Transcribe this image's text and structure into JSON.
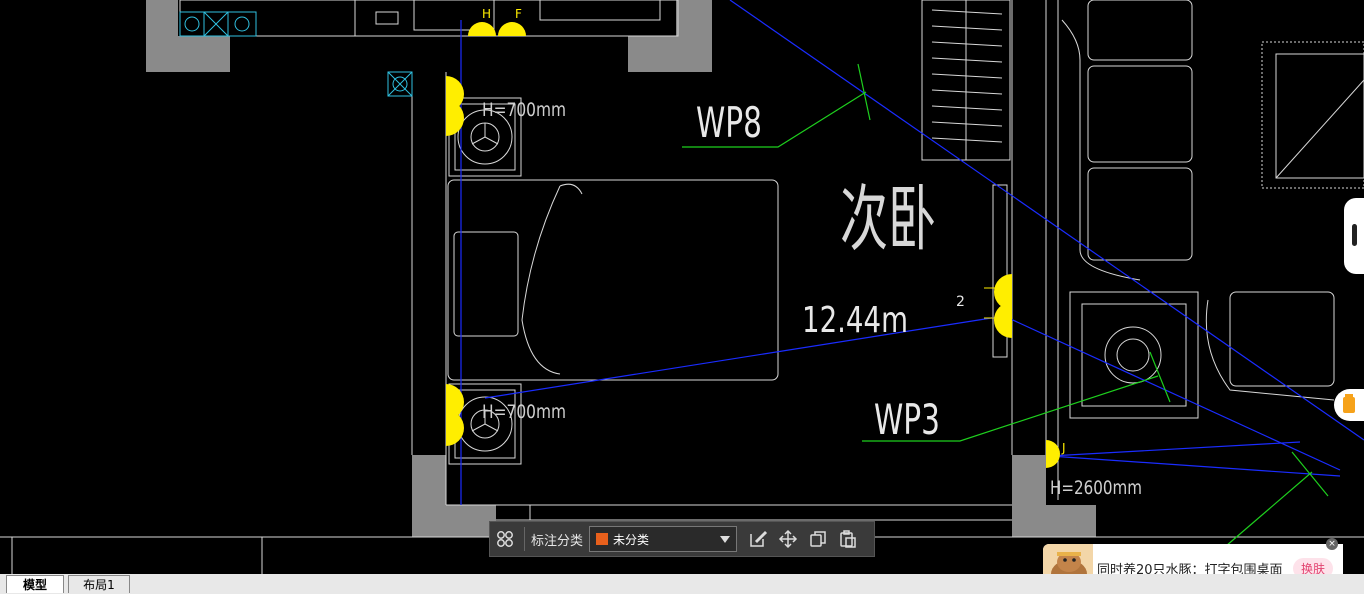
{
  "drawing": {
    "room_label": "次卧",
    "wp8_label": "WP8",
    "wp3_label": "WP3",
    "area_label": "12.44m",
    "height_label_1": "H=700mm",
    "height_label_2": "H=700mm",
    "height_label_3": "H=2600mm",
    "tag_h": "H",
    "tag_f": "F",
    "tag_j": "J",
    "tag_2": "2"
  },
  "toolbar": {
    "category_label": "标注分类",
    "selected_option": "未分类",
    "selected_color": "#e8601c"
  },
  "tabs": {
    "model": "模型",
    "layout1": "布局1"
  },
  "ad": {
    "text": "同时养20只水豚：打字包围桌面",
    "button": "换肤",
    "close": "×"
  },
  "icons": [
    "grid-icon",
    "edit-icon",
    "move-icon",
    "copy-icon",
    "paste-icon",
    "chevron-down-icon",
    "close-icon"
  ]
}
